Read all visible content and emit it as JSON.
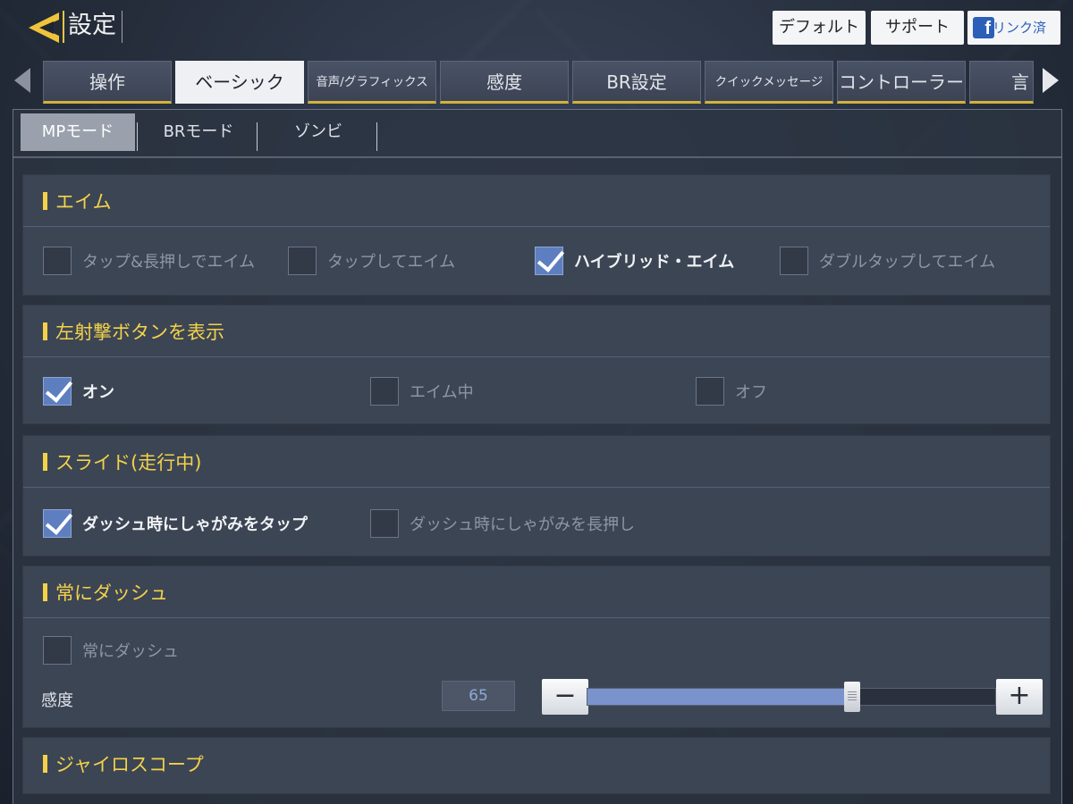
{
  "header": {
    "title": "設定",
    "default_label": "デフォルト",
    "support_label": "サポート",
    "facebook_label": "リンク済"
  },
  "tabs": [
    {
      "label": "操作"
    },
    {
      "label": "ベーシック"
    },
    {
      "label": "音声/グラフィックス"
    },
    {
      "label": "感度"
    },
    {
      "label": "BR設定"
    },
    {
      "label": "クイックメッセージ"
    },
    {
      "label": "コントローラー"
    },
    {
      "label": "言"
    }
  ],
  "active_tab": "ベーシック",
  "subtabs": [
    {
      "label": "MPモード"
    },
    {
      "label": "BRモード"
    },
    {
      "label": "ゾンビ"
    }
  ],
  "active_subtab": "MPモード",
  "sections": {
    "aim": {
      "title": "エイム",
      "options": [
        {
          "label": "タップ&長押しでエイム",
          "checked": false
        },
        {
          "label": "タップしてエイム",
          "checked": false
        },
        {
          "label": "ハイブリッド・エイム",
          "checked": true
        },
        {
          "label": "ダブルタップしてエイム",
          "checked": false
        }
      ]
    },
    "left_fire": {
      "title": "左射撃ボタンを表示",
      "options": [
        {
          "label": "オン",
          "checked": true
        },
        {
          "label": "エイム中",
          "checked": false
        },
        {
          "label": "オフ",
          "checked": false
        }
      ]
    },
    "slide": {
      "title": "スライド(走行中)",
      "options": [
        {
          "label": "ダッシュ時にしゃがみをタップ",
          "checked": true
        },
        {
          "label": "ダッシュ時にしゃがみを長押し",
          "checked": false
        }
      ]
    },
    "always_sprint": {
      "title": "常にダッシュ",
      "options": [
        {
          "label": "常にダッシュ",
          "checked": false
        }
      ],
      "sensitivity_label": "感度",
      "sensitivity_value": "65",
      "sensitivity_fraction": 0.65
    },
    "gyro": {
      "title": "ジャイロスコープ"
    }
  },
  "colors": {
    "accent": "#f3d24a",
    "checkbox_checked": "#5e7fbf",
    "slider_fill": "#7a93cc"
  }
}
